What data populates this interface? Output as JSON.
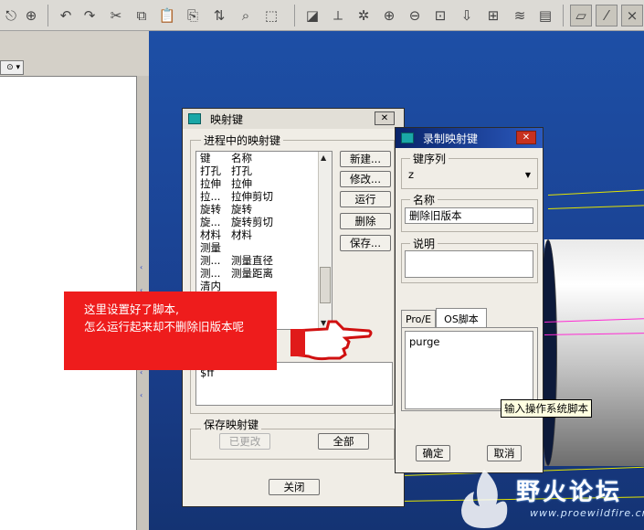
{
  "toolbar": {
    "icons": [
      "redo-icon",
      "model-tree-icon",
      "undo-icon",
      "redo-arrow-icon",
      "cut-icon",
      "copy-icon",
      "paste-icon",
      "paste-special-icon",
      "regenerate-icon",
      "find-icon",
      "select-box-icon",
      "datum-display-icon",
      "csys-icon",
      "spin-center-icon",
      "zoom-in-icon",
      "zoom-out-icon",
      "refit-icon",
      "orient-icon",
      "view-manager-icon",
      "layers-icon",
      "model-display-icon",
      "datum-plane-toggle-icon",
      "datum-axis-toggle-icon",
      "point-toggle-icon"
    ]
  },
  "mapkeys_dialog": {
    "title": "映射键",
    "section_label": "进程中的映射键",
    "col_key": "键",
    "col_name": "名称",
    "rows": [
      {
        "key": "打孔",
        "name": "打孔"
      },
      {
        "key": "拉伸",
        "name": "拉伸"
      },
      {
        "key": "拉...",
        "name": "拉伸剪切"
      },
      {
        "key": "旋转",
        "name": "旋转"
      },
      {
        "key": "旋...",
        "name": "旋转剪切"
      },
      {
        "key": "材料",
        "name": "材料"
      },
      {
        "key": "测量",
        "name": ""
      },
      {
        "key": "测...",
        "name": "测量直径"
      },
      {
        "key": "测...",
        "name": "测量距离"
      },
      {
        "key": "清内存",
        "name": ""
      }
    ],
    "buttons": {
      "new": "新建...",
      "modify": "修改...",
      "run": "运行",
      "delete": "删除",
      "save": "保存..."
    },
    "desc_text": "$ff",
    "save_group_label": "保存映射键",
    "changed_button": "已更改",
    "all_button": "全部",
    "close_button": "关闭"
  },
  "record_dialog": {
    "title": "录制映射键",
    "key_seq_label": "键序列",
    "key_seq_value": "z",
    "name_label": "名称",
    "name_value": "删除旧版本",
    "desc_label": "说明",
    "tab_proe": "Pro/E",
    "tab_os": "OS脚本",
    "script_value": "purge",
    "tooltip": "输入操作系统脚本",
    "ok_button": "确定",
    "cancel_button": "取消"
  },
  "annotation": {
    "line1": "这里设置好了脚本,",
    "line2": "怎么运行起来却不删除旧版本呢"
  },
  "watermark": {
    "name": "野火论坛",
    "url": "www.proewildfire.cn"
  }
}
